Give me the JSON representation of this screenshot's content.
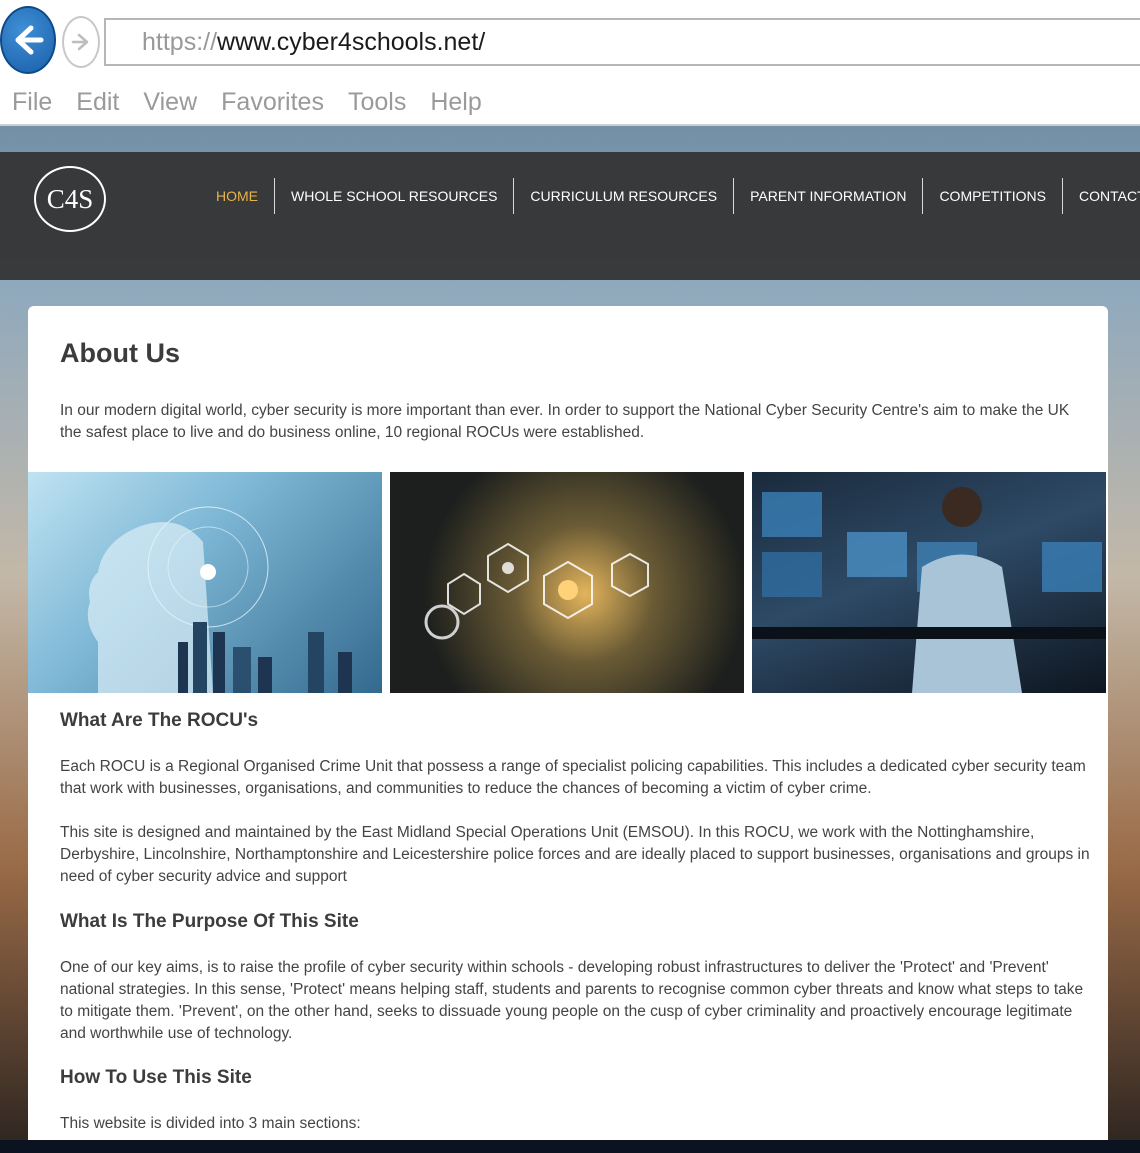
{
  "browser": {
    "url_scheme": "https://",
    "url_host": "www.cyber4schools.net/",
    "menu": [
      "File",
      "Edit",
      "View",
      "Favorites",
      "Tools",
      "Help"
    ]
  },
  "site": {
    "logo_text": "C4S",
    "nav": [
      "HOME",
      "WHOLE SCHOOL RESOURCES",
      "CURRICULUM RESOURCES",
      "PARENT INFORMATION",
      "COMPETITIONS",
      "CONTACT US"
    ],
    "active_nav": "HOME",
    "active_color": "#e8b44a"
  },
  "content": {
    "title": "About Us",
    "intro": "In our modern digital world, cyber security is more important than ever. In order to support the National Cyber Security Centre's aim to make the UK the safest place to live and do business online, 10 regional ROCUs were established.",
    "h_rocu": "What Are The ROCU's",
    "p_rocu1": "Each ROCU is a Regional Organised Crime Unit that possess a range of specialist policing capabilities.  This includes a dedicated cyber security team that work with businesses, organisations, and communities to reduce the chances of becoming a victim of cyber crime.",
    "p_rocu2": "This site is designed and maintained by the East Midland Special Operations Unit (EMSOU). In this ROCU, we work with the Nottinghamshire, Derbyshire, Lincolnshire, Northamptonshire and Leicestershire police forces and are ideally placed to support businesses, organisations and groups in need of cyber security advice and support",
    "h_purpose": "What Is The Purpose Of This Site",
    "p_purpose": "One of our key aims, is to raise the profile of cyber security within schools - developing robust infrastructures to deliver the 'Protect' and 'Prevent' national strategies. In this sense, 'Protect' means helping staff, students and parents to recognise common cyber threats and know what steps to take to mitigate them.  'Prevent', on the other hand, seeks to dissuade young people on the cusp of cyber criminality and proactively encourage legitimate and worthwhile use of technology.",
    "h_howto": "How To Use This Site",
    "p_howto": "This website is divided into 3 main sections:"
  }
}
